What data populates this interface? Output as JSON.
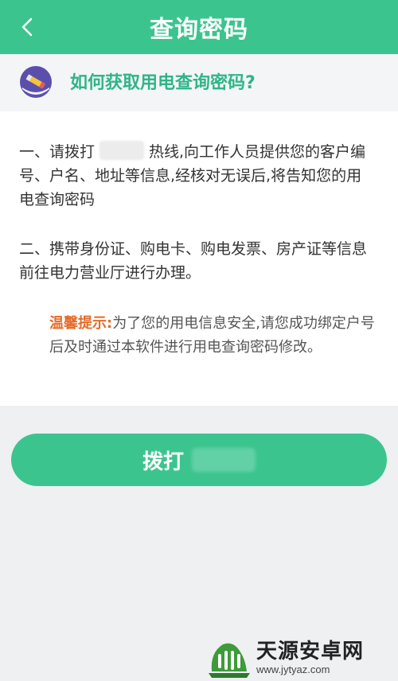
{
  "header": {
    "title": "查询密码",
    "back_icon": "chevron-left-icon"
  },
  "question": {
    "icon": "pencil-icon",
    "text": "如何获取用电查询密码?"
  },
  "content": {
    "step1_prefix": "一、请拨打",
    "step1_suffix": "热线,向工作人员提供您的客户编号、户名、地址等信息,经核对无误后,将告知您的用电查询密码",
    "step2": "二、携带身份证、购电卡、购电发票、房产证等信息前往电力营业厅进行办理。",
    "tip_label": "温馨提示:",
    "tip_text": "为了您的用电信息安全,请您成功绑定户号后及时通过本软件进行用电查询密码修改。"
  },
  "call_button": {
    "label": "拨打"
  },
  "watermark": {
    "name": "天源安卓网",
    "url": "www.jytyaz.com"
  },
  "colors": {
    "primary": "#3cc48f",
    "question_text": "#2fb587",
    "tip_label": "#e56b2a"
  }
}
